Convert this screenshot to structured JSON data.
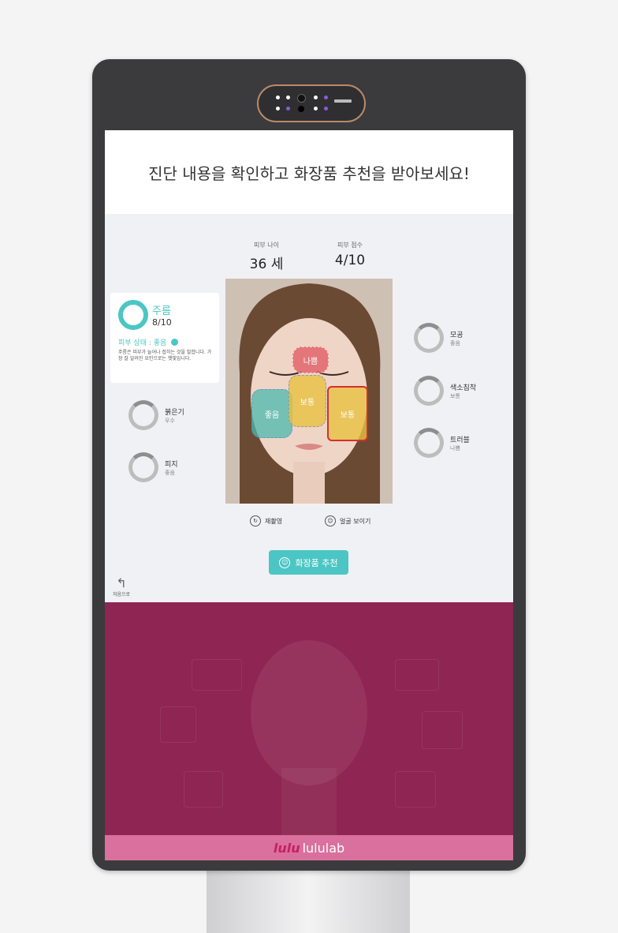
{
  "header": {
    "title": "진단 내용을 확인하고 화장품 추천을 받아보세요!"
  },
  "stats": {
    "skin_age": {
      "label": "피부 나이",
      "value": "36 세"
    },
    "skin_score": {
      "label": "피부 점수",
      "value": "4/10"
    }
  },
  "face_zones": {
    "forehead": "나쁨",
    "left_cheek": "좋음",
    "nose": "보통",
    "right_cheek": "보통"
  },
  "wrinkle_card": {
    "title": "주름",
    "score": "8/10",
    "status": "피부 상태 : 좋음",
    "description": "주름은 피부가 늘어나 접히는 것을 말합니다. 가장 잘 알려진 요인으로는 햇빛입니다."
  },
  "left_metrics": [
    {
      "name": "붉은기",
      "state": "우수"
    },
    {
      "name": "피지",
      "state": "좋음"
    }
  ],
  "right_metrics": [
    {
      "name": "모공",
      "state": "좋음"
    },
    {
      "name": "색소침착",
      "state": "보통"
    },
    {
      "name": "트러블",
      "state": "나쁨"
    }
  ],
  "actions": {
    "retake": "재촬영",
    "show_face": "얼굴 보이기"
  },
  "recommend_button": "화장품 추천",
  "back_label": "처음으로",
  "brand": "lululab",
  "colors": {
    "accent": "#4cc6c4",
    "brand_pink": "#d9709e",
    "panel": "#8e2552",
    "bad": "#e05b63",
    "neutral": "#e8c040"
  }
}
